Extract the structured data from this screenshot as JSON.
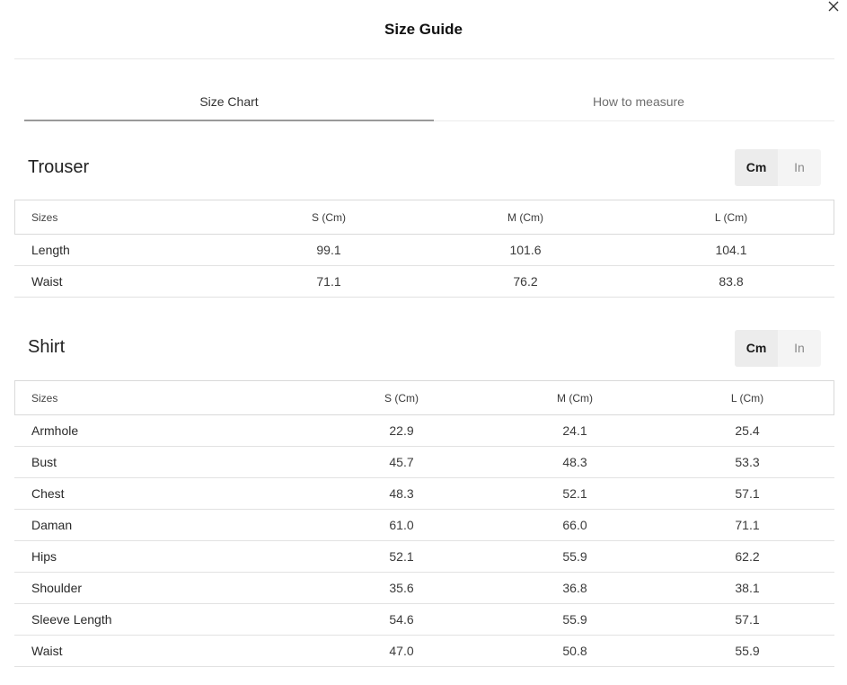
{
  "modal": {
    "title": "Size Guide"
  },
  "tabs": [
    {
      "label": "Size Chart",
      "active": true
    },
    {
      "label": "How to measure",
      "active": false
    }
  ],
  "units": {
    "cm": "Cm",
    "in": "In",
    "selected": "Cm"
  },
  "trouser": {
    "title": "Trouser",
    "headers": [
      "Sizes",
      "S (Cm)",
      "M (Cm)",
      "L (Cm)"
    ],
    "rows": [
      {
        "name": "Length",
        "s": "99.1",
        "m": "101.6",
        "l": "104.1"
      },
      {
        "name": "Waist",
        "s": "71.1",
        "m": "76.2",
        "l": "83.8"
      }
    ]
  },
  "shirt": {
    "title": "Shirt",
    "headers": [
      "Sizes",
      "S (Cm)",
      "M (Cm)",
      "L (Cm)"
    ],
    "rows": [
      {
        "name": "Armhole",
        "s": "22.9",
        "m": "24.1",
        "l": "25.4"
      },
      {
        "name": "Bust",
        "s": "45.7",
        "m": "48.3",
        "l": "53.3"
      },
      {
        "name": "Chest",
        "s": "48.3",
        "m": "52.1",
        "l": "57.1"
      },
      {
        "name": "Daman",
        "s": "61.0",
        "m": "66.0",
        "l": "71.1"
      },
      {
        "name": "Hips",
        "s": "52.1",
        "m": "55.9",
        "l": "62.2"
      },
      {
        "name": "Shoulder",
        "s": "35.6",
        "m": "36.8",
        "l": "38.1"
      },
      {
        "name": "Sleeve Length",
        "s": "54.6",
        "m": "55.9",
        "l": "57.1"
      },
      {
        "name": "Waist",
        "s": "47.0",
        "m": "50.8",
        "l": "55.9"
      }
    ]
  }
}
